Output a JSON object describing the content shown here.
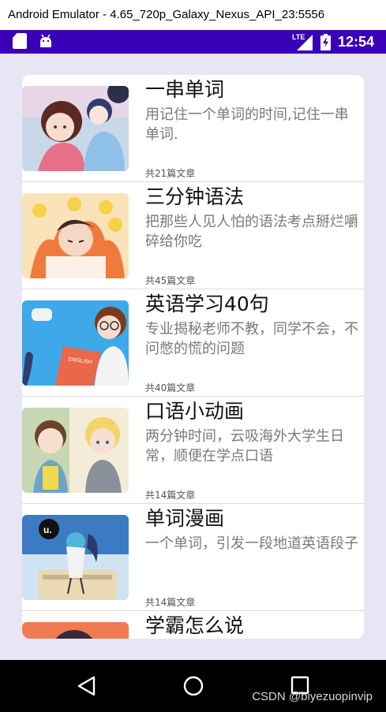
{
  "window": {
    "title": "Android Emulator - 4.65_720p_Galaxy_Nexus_API_23:5556"
  },
  "status_bar": {
    "time": "12:54",
    "network_label": "LTE",
    "icons": [
      "sd-card-icon",
      "android-debug-icon",
      "lte-signal-icon",
      "battery-charging-icon"
    ],
    "color": "#3a00b8"
  },
  "courses": [
    {
      "title": "一串单词",
      "description": "用记住一个单词的时间,记住一串单词.",
      "count": "共21篇文章"
    },
    {
      "title": "三分钟语法",
      "description": "把那些人见人怕的语法考点掰烂嚼碎给你吃",
      "count": "共45篇文章"
    },
    {
      "title": "英语学习40句",
      "description": "专业揭秘老师不教，同学不会，不问憋的慌的问题",
      "count": "共40篇文章"
    },
    {
      "title": "口语小动画",
      "description": "两分钟时间，云吸海外大学生日常，顺便在学点口语",
      "count": "共14篇文章"
    },
    {
      "title": "单词漫画",
      "description": "一个单词，引发一段地道英语段子",
      "count": "共14篇文章"
    },
    {
      "title": "学霸怎么说",
      "description": "",
      "count": ""
    }
  ],
  "thumbnails": {
    "book_text": "ENGLISH",
    "badge_letter": "u."
  },
  "nav_bar": {
    "icons": [
      "back-icon",
      "home-icon",
      "recent-apps-icon"
    ]
  },
  "watermark": "CSDN @biyezuopinvip",
  "colors": {
    "background": "#e6e6f5",
    "title": "#111111",
    "description": "#7a7a7a"
  }
}
